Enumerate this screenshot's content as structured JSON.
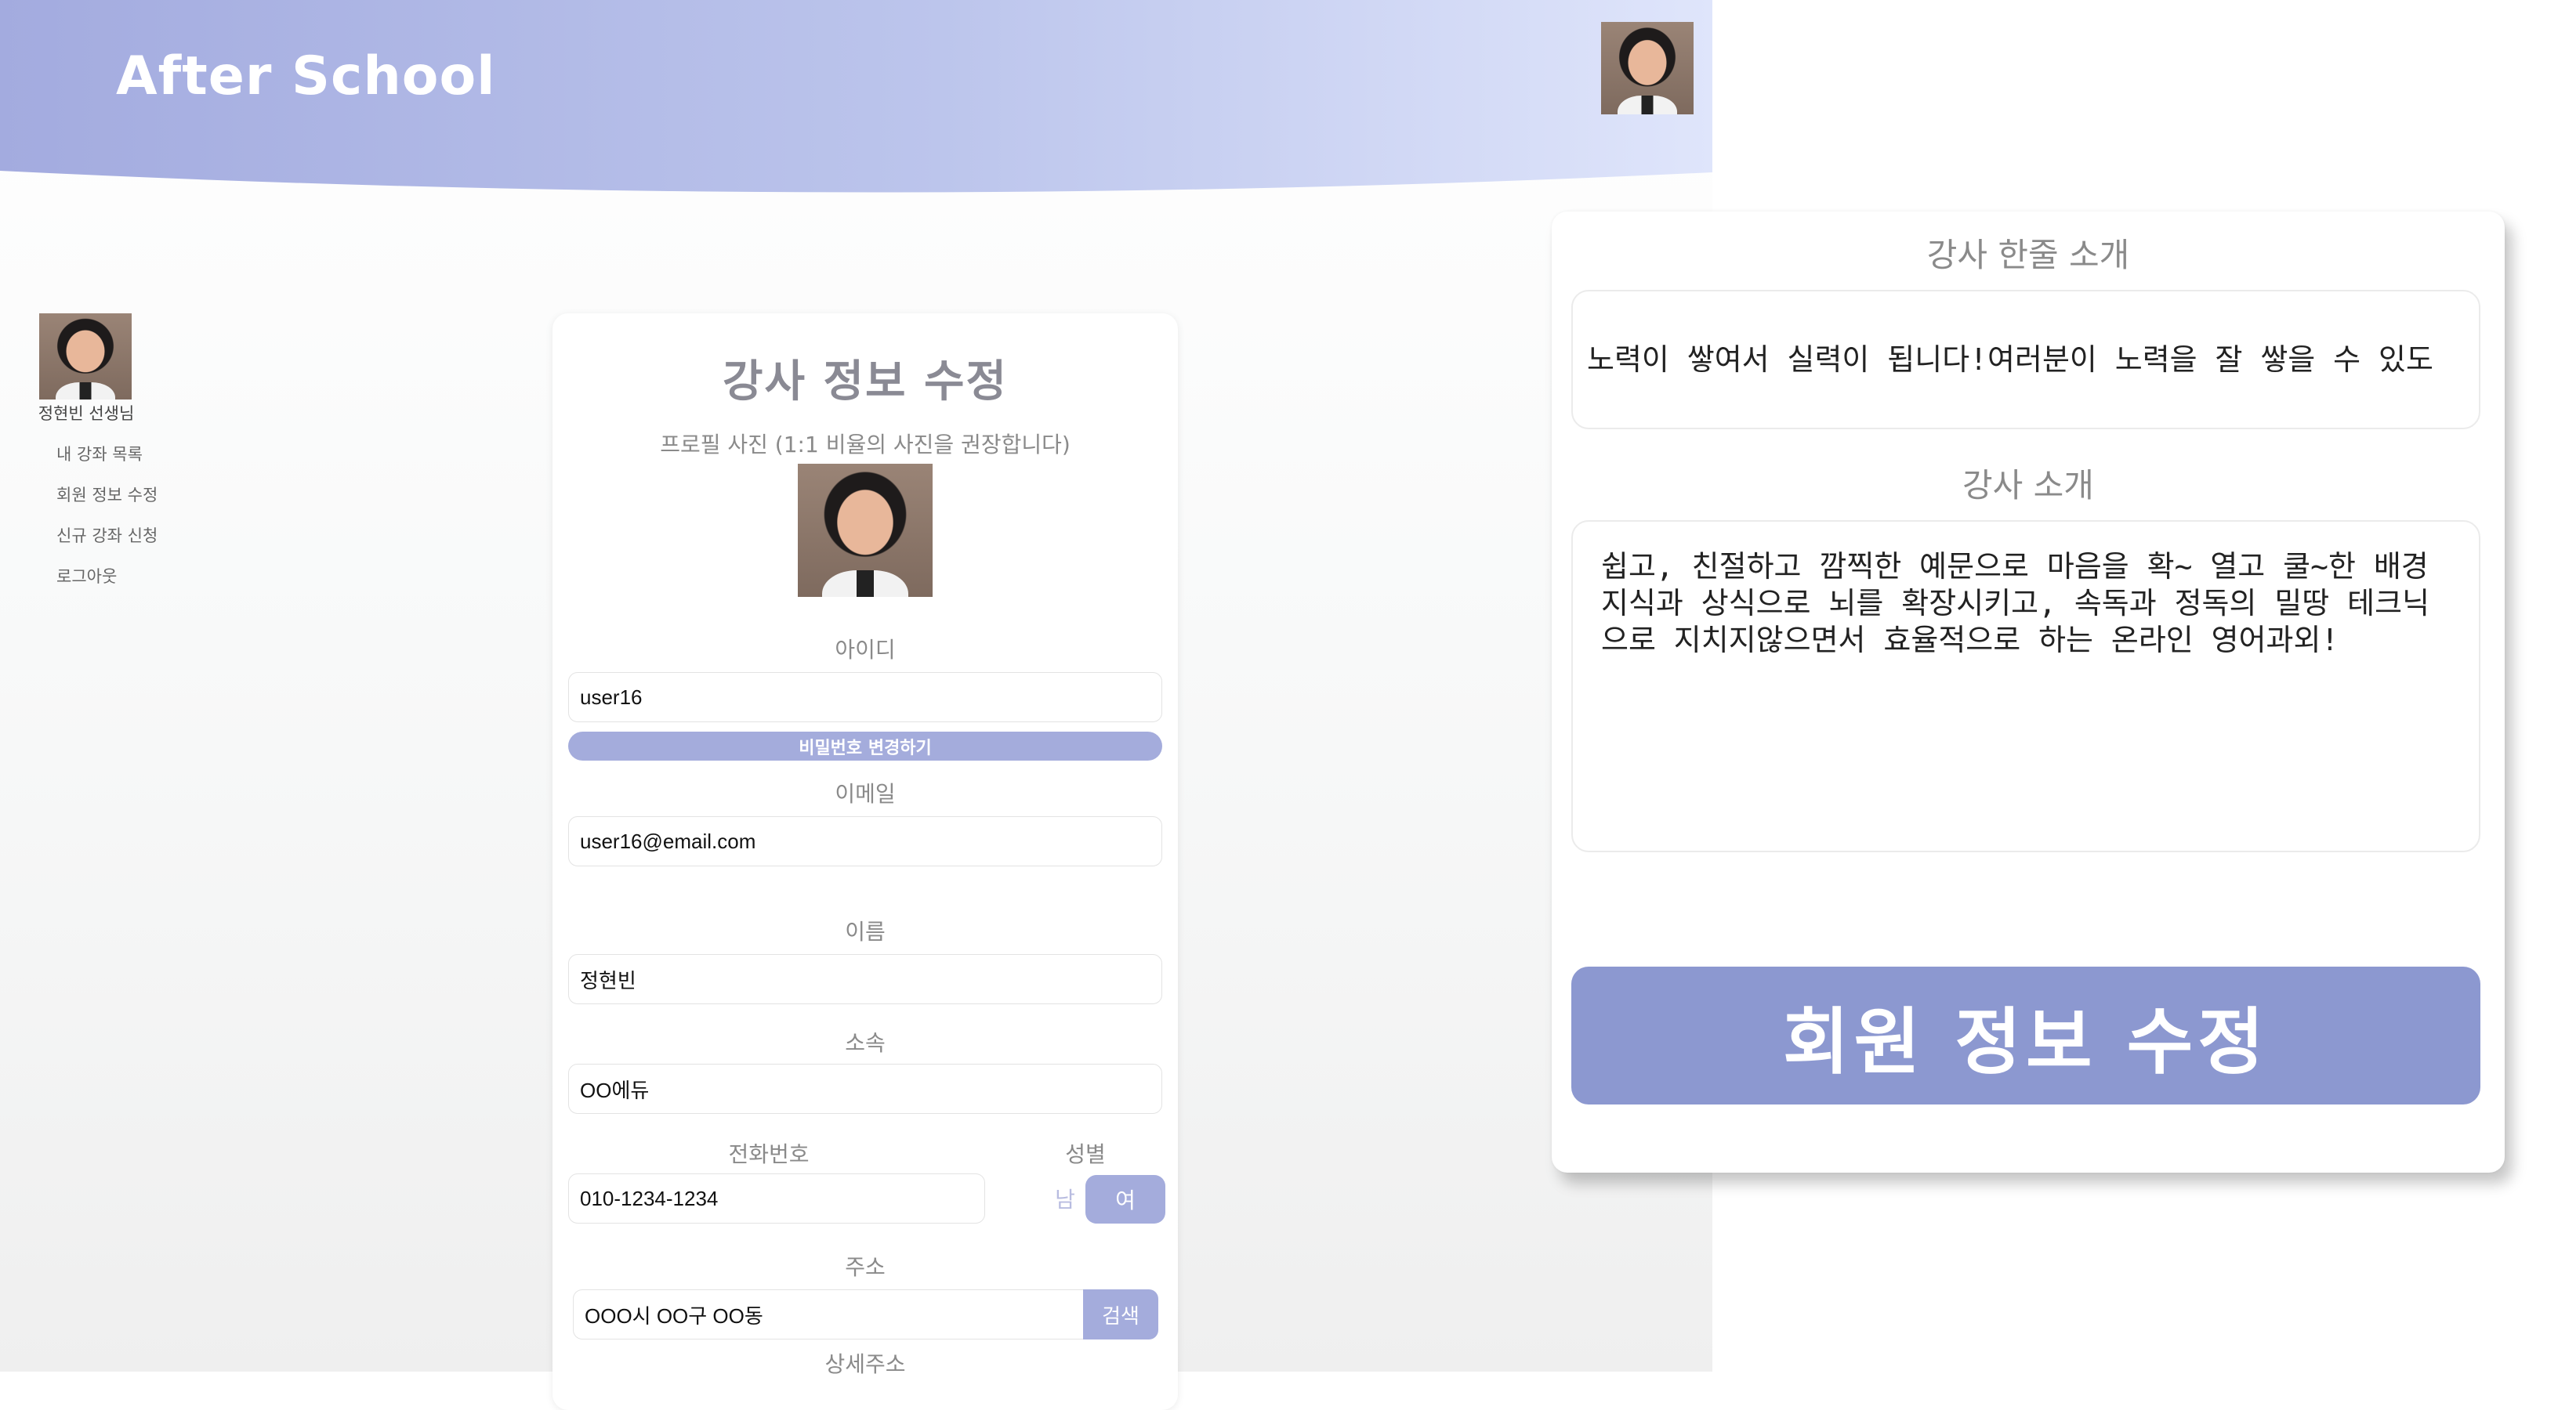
{
  "header": {
    "app_title": "After School"
  },
  "sidebar": {
    "user_name": "정현빈 선생님",
    "menu": [
      "내 강좌 목록",
      "회원 정보 수정",
      "신규 강좌 신청",
      "로그아웃"
    ]
  },
  "form": {
    "title": "강사 정보 수정",
    "photo_hint": "프로필 사진 (1:1 비율의 사진을 권장합니다)",
    "id_label": "아이디",
    "id_value": "user16",
    "password_button": "비밀번호 변경하기",
    "email_label": "이메일",
    "email_value": "user16@email.com",
    "name_label": "이름",
    "name_value": "정현빈",
    "affiliation_label": "소속",
    "affiliation_value": "OO에듀",
    "phone_label": "전화번호",
    "phone_value": "010-1234-1234",
    "gender_label": "성별",
    "gender_options": [
      "남",
      "여"
    ],
    "gender_selected": "여",
    "address_label": "주소",
    "address_value": "OOO시 OO구 OO동",
    "search_button": "검색",
    "detail_address_label": "상세주소"
  },
  "intro_card": {
    "oneline_label": "강사 한줄 소개",
    "oneline_value": "노력이 쌓여서 실력이 됩니다!여러분이 노력을 잘 쌓을 수 있도",
    "intro_label": "강사 소개",
    "intro_value": "쉽고, 친절하고 깜찍한 예문으로 마음을 확~ 열고 쿨~한 배경지식과 상식으로 뇌를 확장시키고, 속독과 정독의 밀땅 테크닉으로 지치지않으면서 효율적으로 하는 온라인 영어과외!",
    "submit_button": "회원 정보 수정"
  },
  "colors": {
    "accent": "#a4acdc",
    "submit": "#8c98d0",
    "header_start": "#a3abdf",
    "header_end": "#dfe5fb"
  }
}
